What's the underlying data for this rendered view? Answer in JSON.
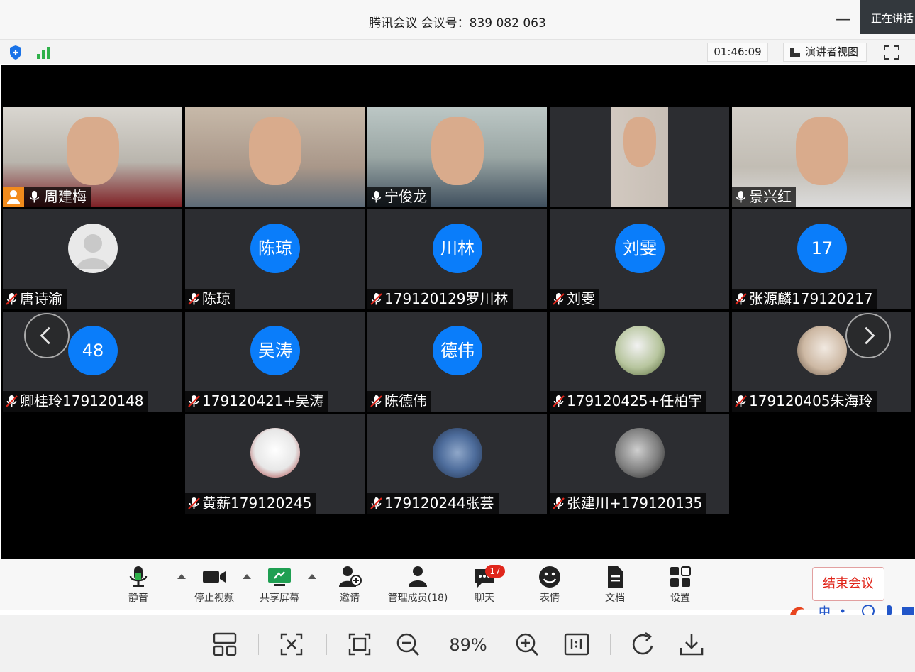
{
  "window": {
    "title": "腾讯会议 会议号：839 082 063",
    "minimize_label": "—",
    "speaking_label": "正在讲话"
  },
  "statusbar": {
    "timer": "01:46:09",
    "view_label": "演讲者视图",
    "icons": [
      "shield-icon",
      "signal-icon",
      "speaker-view-icon",
      "fullscreen-icon"
    ]
  },
  "participants": [
    {
      "name": "周建梅",
      "type": "video",
      "host": true,
      "mic": "on"
    },
    {
      "name": "",
      "type": "video",
      "mic": "none"
    },
    {
      "name": "宁俊龙",
      "type": "video",
      "mic": "on"
    },
    {
      "name": "",
      "type": "video",
      "mic": "none"
    },
    {
      "name": "景兴红",
      "type": "video",
      "mic": "on"
    },
    {
      "name": "唐诗渝",
      "type": "avatar-default",
      "mic": "muted"
    },
    {
      "name": "陈琼",
      "type": "avatar",
      "avatar_text": "陈琼",
      "mic": "muted"
    },
    {
      "name": "179120129罗川林",
      "type": "avatar",
      "avatar_text": "川林",
      "mic": "muted"
    },
    {
      "name": "刘雯",
      "type": "avatar",
      "avatar_text": "刘雯",
      "mic": "muted"
    },
    {
      "name": "张源麟179120217",
      "type": "avatar",
      "avatar_text": "17",
      "mic": "muted"
    },
    {
      "name": "卿桂玲179120148",
      "type": "avatar",
      "avatar_text": "48",
      "mic": "muted"
    },
    {
      "name": "179120421+吴涛",
      "type": "avatar",
      "avatar_text": "吴涛",
      "mic": "muted"
    },
    {
      "name": "陈德伟",
      "type": "avatar",
      "avatar_text": "德伟",
      "mic": "muted"
    },
    {
      "name": "179120425+任柏宇",
      "type": "photo",
      "mic": "muted"
    },
    {
      "name": "179120405朱海玲",
      "type": "photo",
      "mic": "muted"
    },
    {
      "name": "黄薪179120245",
      "type": "photo",
      "mic": "muted"
    },
    {
      "name": "179120244张芸",
      "type": "photo",
      "mic": "muted"
    },
    {
      "name": "张建川+179120135",
      "type": "photo",
      "mic": "muted"
    }
  ],
  "toolbar": {
    "mute": "静音",
    "stop_video": "停止视频",
    "share_screen": "共享屏幕",
    "invite": "邀请",
    "manage_members": "管理成员(18)",
    "chat": "聊天",
    "chat_badge": "17",
    "reactions": "表情",
    "documents": "文档",
    "settings": "设置",
    "end_meeting": "结束会议",
    "ime_text": "中"
  },
  "viewer": {
    "zoom": "89%",
    "icons": [
      "layout-icon",
      "fit-icon",
      "crop-icon",
      "zoom-out-icon",
      "zoom-in-icon",
      "actual-size-icon",
      "rotate-icon",
      "download-icon"
    ]
  },
  "colors": {
    "avatar_blue": "#0a7dfa",
    "host_orange": "#f28b1c",
    "end_red": "#e0261b",
    "tile_bg": "#2c2d31"
  }
}
